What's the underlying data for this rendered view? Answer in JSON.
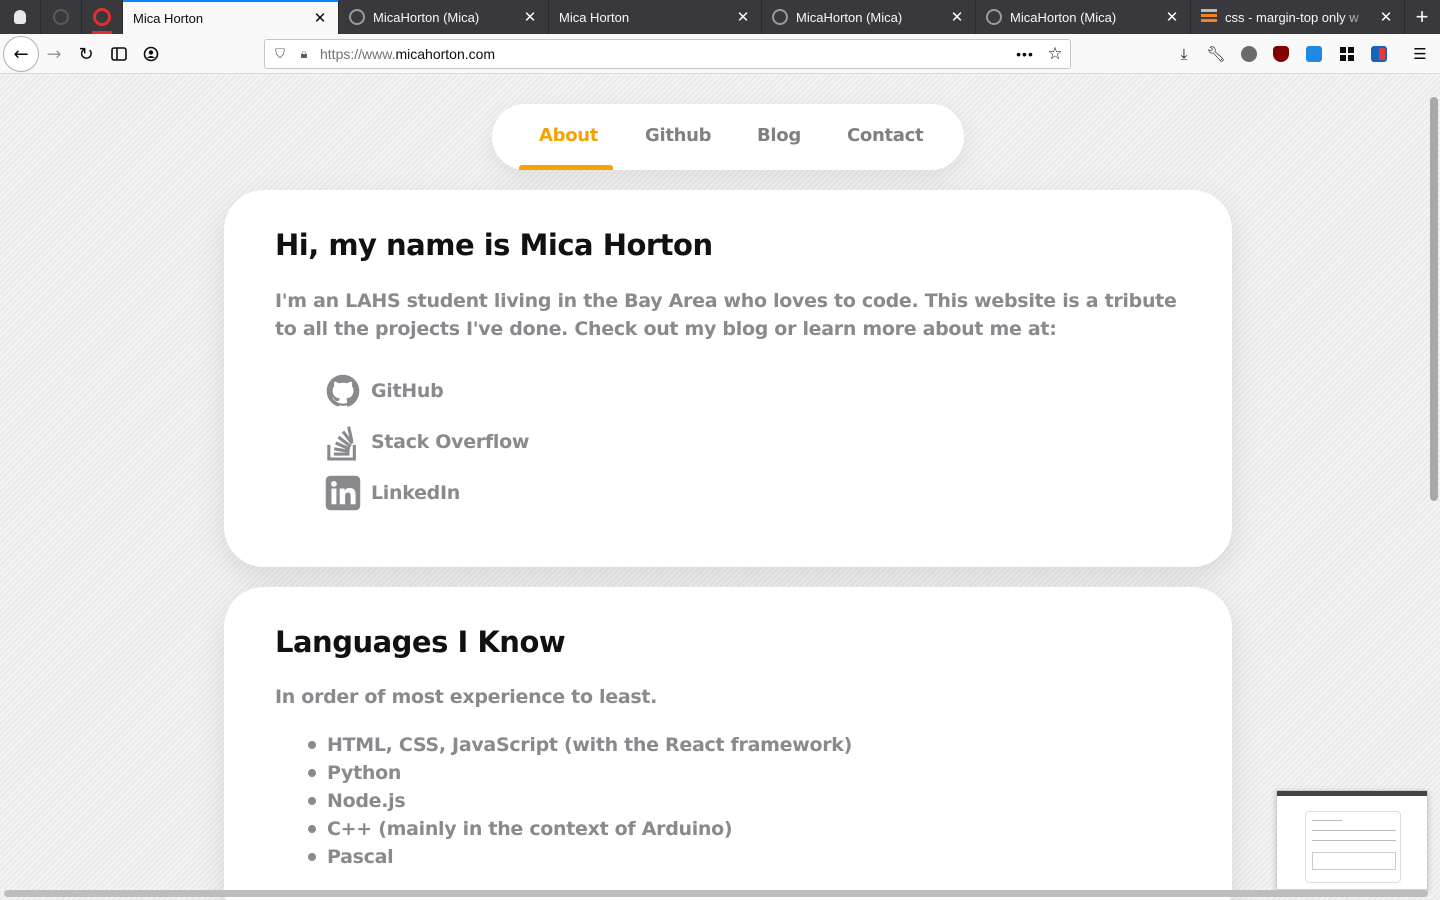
{
  "browser": {
    "tabs": [
      {
        "title": "Mica Horton",
        "active": true
      },
      {
        "title": "MicaHorton (Mica)",
        "active": false
      },
      {
        "title": "Mica Horton",
        "active": false
      },
      {
        "title": "MicaHorton (Mica)",
        "active": false
      },
      {
        "title": "MicaHorton (Mica)",
        "active": false
      },
      {
        "title": "css - margin-top only w",
        "active": false
      }
    ],
    "close_glyph": "✕",
    "new_tab_glyph": "+",
    "url_protocol": "https://www.",
    "url_host": "micahorton.com",
    "page_actions_glyph": "•••"
  },
  "site": {
    "nav": [
      {
        "label": "About",
        "active": true
      },
      {
        "label": "Github",
        "active": false
      },
      {
        "label": "Blog",
        "active": false
      },
      {
        "label": "Contact",
        "active": false
      }
    ],
    "accent_color": "#f5a300",
    "about": {
      "heading": "Hi, my name is Mica Horton",
      "intro": "I'm an LAHS student living in the Bay Area who loves to code. This website is a tribute to all the projects I've done. Check out my blog or learn more about me at:",
      "links": [
        {
          "label": "GitHub",
          "icon": "github-icon"
        },
        {
          "label": "Stack Overflow",
          "icon": "stackoverflow-icon"
        },
        {
          "label": "LinkedIn",
          "icon": "linkedin-icon"
        }
      ]
    },
    "languages": {
      "heading": "Languages I Know",
      "subtitle": "In order of most experience to least.",
      "items": [
        "HTML, CSS, JavaScript (with the React framework)",
        "Python",
        "Node.js",
        "C++ (mainly in the context of Arduino)",
        "Pascal"
      ]
    }
  }
}
